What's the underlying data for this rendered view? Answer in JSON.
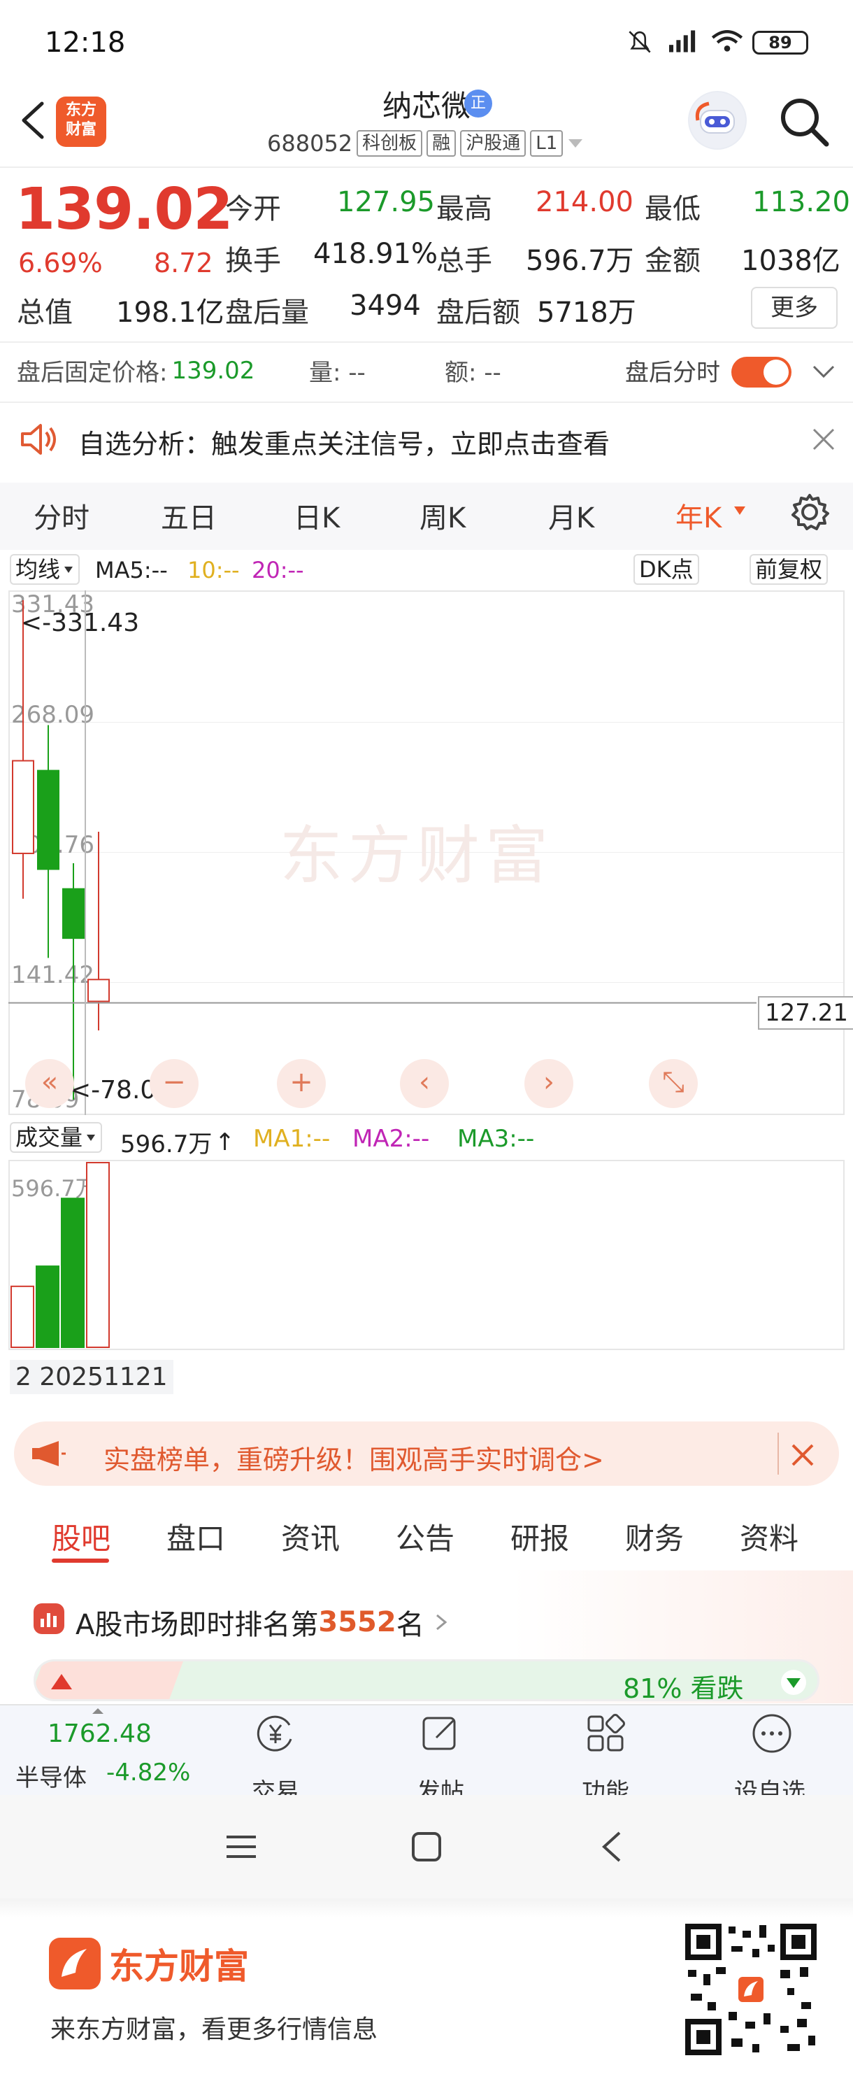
{
  "status": {
    "time": "12:18",
    "battery": "89"
  },
  "header": {
    "logo_text": "东方财富",
    "stock_name": "纳芯微",
    "badge": "正",
    "code": "688052",
    "tags": [
      "科创板",
      "融",
      "沪股通",
      "L1"
    ]
  },
  "quote": {
    "price": "139.02",
    "pct": "6.69%",
    "change": "8.72",
    "fields": [
      {
        "label": "今开",
        "value": "127.95",
        "color": "green"
      },
      {
        "label": "最高",
        "value": "214.00",
        "color": "red"
      },
      {
        "label": "最低",
        "value": "113.20",
        "color": "green"
      },
      {
        "label": "换手",
        "value": "418.91%",
        "color": "dark"
      },
      {
        "label": "总手",
        "value": "596.7万",
        "color": "dark"
      },
      {
        "label": "金额",
        "value": "1038亿",
        "color": "dark"
      },
      {
        "label": "总值",
        "value": "198.1亿",
        "color": "dark"
      },
      {
        "label": "盘后量",
        "value": "3494",
        "color": "dark"
      },
      {
        "label": "盘后额",
        "value": "5718万",
        "color": "dark"
      }
    ],
    "more": "更多"
  },
  "after_hours": {
    "fixed_price_label": "盘后固定价格:",
    "fixed_price": "139.02",
    "vol_label": "量: --",
    "amt_label": "额: --",
    "timeshare_label": "盘后分时"
  },
  "alert": {
    "text": "自选分析：触发重点关注信号，立即点击查看"
  },
  "period_tabs": [
    "分时",
    "五日",
    "日K",
    "周K",
    "月K",
    "年K"
  ],
  "period_active": "年K",
  "ma": {
    "type": "均线",
    "ma5": "MA5:--",
    "ma10": "10:--",
    "ma20": "20:--",
    "dk": "DK点",
    "adjust": "前复权"
  },
  "kline": {
    "axis_labels": [
      "331.43",
      "268.09",
      "204.76",
      "141.42",
      "78.09"
    ],
    "max_label": "<-331.43",
    "min_label": "<-78.09",
    "current_line_label": "127.21",
    "current_line_value": 127.21,
    "range": [
      78.09,
      331.43
    ],
    "candles": [
      {
        "open": 203.0,
        "close": 250.0,
        "high": 331.43,
        "low": 180.0,
        "color": "red",
        "hollow": true
      },
      {
        "open": 245.0,
        "close": 195.0,
        "high": 268.09,
        "low": 150.0,
        "color": "green",
        "hollow": false
      },
      {
        "open": 185.0,
        "close": 160.0,
        "high": 198.0,
        "low": 78.09,
        "color": "green",
        "hollow": false
      },
      {
        "open": 127.95,
        "close": 139.02,
        "high": 214.0,
        "low": 113.2,
        "color": "red",
        "hollow": true
      }
    ],
    "colors": {
      "red": "#d23a2e",
      "green": "#1aa01a"
    }
  },
  "volume": {
    "label": "成交量",
    "value": "596.7万",
    "arrow": "↑",
    "ma1": "MA1:--",
    "ma2": "MA2:--",
    "ma3": "MA3:--",
    "axis_top": "596.7万",
    "max": 596.7,
    "bars": [
      {
        "value": 197,
        "color": "red",
        "hollow": true
      },
      {
        "value": 262,
        "color": "green",
        "hollow": false
      },
      {
        "value": 481,
        "color": "green",
        "hollow": false
      },
      {
        "value": 596.7,
        "color": "red",
        "hollow": true
      }
    ],
    "date_label": "2 20251121"
  },
  "banner": {
    "text": "实盘榜单，重磅升级！围观高手实时调仓>"
  },
  "content_tabs": [
    "股吧",
    "盘口",
    "资讯",
    "公告",
    "研报",
    "财务",
    "资料"
  ],
  "rank": {
    "prefix": "A股市场即时排名第",
    "number": "3552",
    "suffix": "名",
    "bar_text": "81% 看跌"
  },
  "bottom": {
    "index_value": "1762.48",
    "index_name": "半导体",
    "index_pct": "-4.82%",
    "items": [
      "交易",
      "发帖",
      "功能",
      "设自选"
    ]
  },
  "footer": {
    "brand": "东方财富",
    "slogan": "来东方财富，看更多行情信息"
  }
}
